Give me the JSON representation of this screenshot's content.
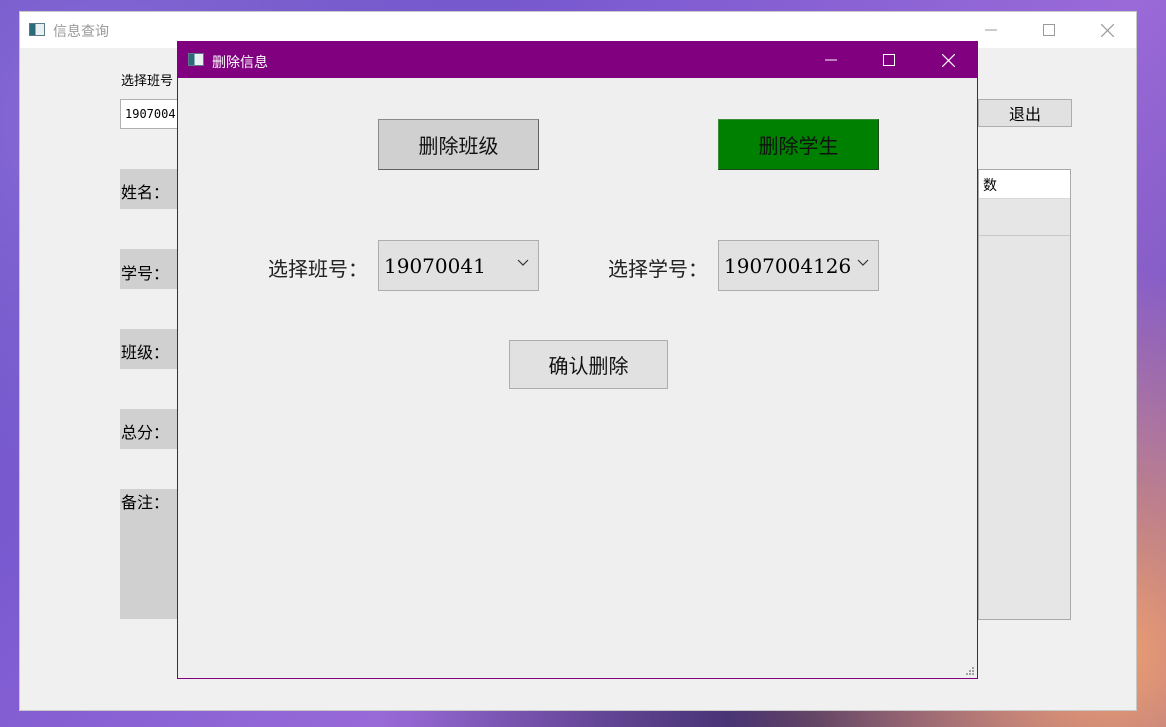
{
  "main_window": {
    "title": "信息查询",
    "class_label": "选择班号",
    "class_value_partial": "1907004",
    "exit_label": "退出",
    "name_label": "姓名：",
    "id_label": "学号：",
    "class_field_label": "班级：",
    "total_label": "总分：",
    "note_label": "备注：",
    "table_header": "数"
  },
  "dialog": {
    "title": "删除信息",
    "delete_class_label": "删除班级",
    "delete_student_label": "删除学生",
    "select_class_label": "选择班号：",
    "select_class_value": "19070041",
    "select_student_label": "选择学号：",
    "select_student_value": "1907004126",
    "confirm_label": "确认删除",
    "accent_color": "#800080",
    "active_button_color": "#008000"
  },
  "icons": {
    "minimize": "minimize-icon",
    "maximize": "maximize-icon",
    "close": "close-icon",
    "dropdown": "chevron-down-icon"
  }
}
